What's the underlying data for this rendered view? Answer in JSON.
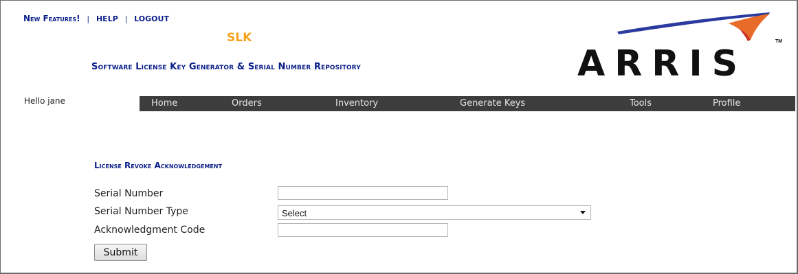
{
  "header": {
    "links": {
      "new_features": "New Features!",
      "help": "HELP",
      "logout": "LOGOUT",
      "separator": "|"
    },
    "app_short": "SLK",
    "subtitle": "Software License Key Generator & Serial Number Repository",
    "logo": {
      "text": "ARRIS",
      "tm": "TM",
      "icon": "arris-swoosh-logo"
    }
  },
  "user": {
    "greeting": "Hello jane"
  },
  "nav": {
    "items": [
      "Home",
      "Orders",
      "Inventory",
      "Generate Keys",
      "Tools",
      "Profile"
    ]
  },
  "form": {
    "title": "License Revoke Acknowledgement",
    "fields": {
      "serial_number": {
        "label": "Serial Number",
        "value": ""
      },
      "serial_number_type": {
        "label": "Serial Number Type",
        "selected": "Select"
      },
      "ack_code": {
        "label": "Acknowledgment Code",
        "value": ""
      }
    },
    "submit_label": "Submit"
  },
  "colors": {
    "brand_blue": "#0b1f8a",
    "accent_orange": "#f7a11b",
    "nav_bg": "#3d3d3d",
    "logo_orange": "#e96b2a",
    "logo_blue": "#2a3a9e"
  }
}
